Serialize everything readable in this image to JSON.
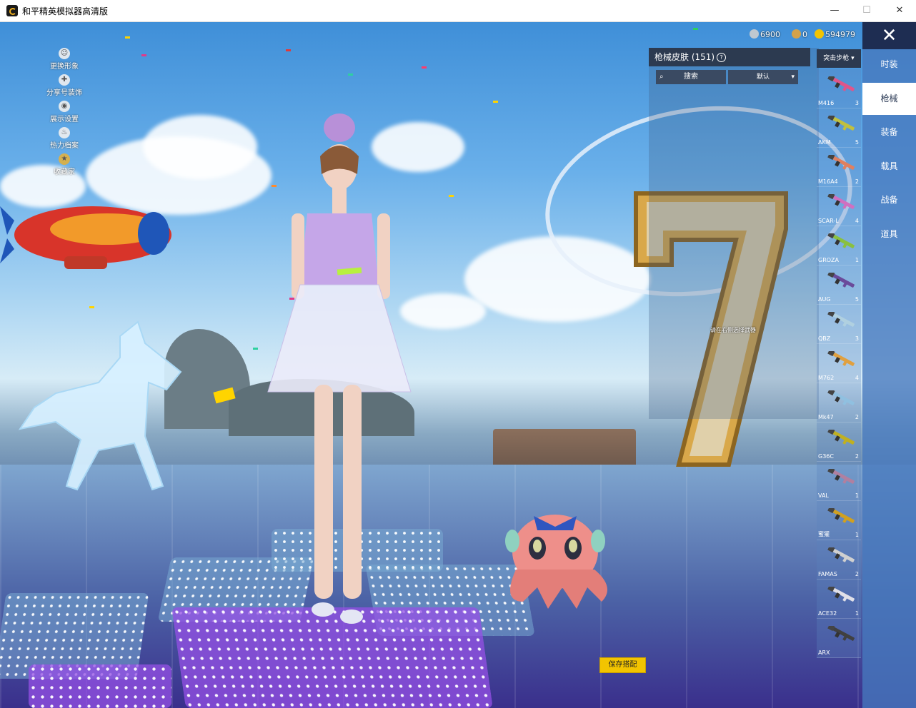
{
  "window": {
    "title": "和平精英模拟器高清版",
    "minimize": "—",
    "maximize": "☐",
    "close": "✕"
  },
  "left_menu": [
    {
      "icon": "avatar-icon",
      "label": "更换形象"
    },
    {
      "icon": "share-icon",
      "label": "分享号装饰"
    },
    {
      "icon": "eye-icon",
      "label": "展示设置"
    },
    {
      "icon": "flame-icon",
      "label": "热力档案"
    },
    {
      "icon": "badge-icon",
      "label": "收藏家"
    }
  ],
  "currency": [
    {
      "icon": "coin-silver-icon",
      "value": "6900",
      "color": "#c0c8d0"
    },
    {
      "icon": "coin-bronze-icon",
      "value": "0",
      "color": "#d4a24a"
    },
    {
      "icon": "coin-gold-icon",
      "value": "594979",
      "color": "#f2c400"
    }
  ],
  "right_tabs": [
    {
      "label": "时装",
      "active": false
    },
    {
      "label": "枪械",
      "active": true
    },
    {
      "label": "装备",
      "active": false
    },
    {
      "label": "载具",
      "active": false
    },
    {
      "label": "战备",
      "active": false
    },
    {
      "label": "道具",
      "active": false
    }
  ],
  "close_label": "✕",
  "panel": {
    "title": "枪械皮肤 (151)",
    "search_label": "搜索",
    "sort_label": "默认",
    "hint": "请在右侧选择武器"
  },
  "category_dropdown": "突击步枪",
  "guns": [
    {
      "name": "M416",
      "count": "3",
      "color": "#e0558a"
    },
    {
      "name": "AKM",
      "count": "5",
      "color": "#c0c040"
    },
    {
      "name": "M16A4",
      "count": "2",
      "color": "#e08060"
    },
    {
      "name": "SCAR-L",
      "count": "4",
      "color": "#d070c0"
    },
    {
      "name": "GROZA",
      "count": "1",
      "color": "#8ac040"
    },
    {
      "name": "AUG",
      "count": "5",
      "color": "#6a4a9a"
    },
    {
      "name": "QBZ",
      "count": "3",
      "color": "#b0d0e0"
    },
    {
      "name": "M762",
      "count": "4",
      "color": "#e0a040"
    },
    {
      "name": "Mk47",
      "count": "2",
      "color": "#90c0e0"
    },
    {
      "name": "G36C",
      "count": "2",
      "color": "#c0b020"
    },
    {
      "name": "VAL",
      "count": "1",
      "color": "#b080a0"
    },
    {
      "name": "蜜獾",
      "count": "1",
      "color": "#d0a020"
    },
    {
      "name": "FAMAS",
      "count": "2",
      "color": "#d0d0d0"
    },
    {
      "name": "ACE32",
      "count": "1",
      "color": "#e0e0e8"
    },
    {
      "name": "ARX",
      "count": "",
      "color": "#404040"
    }
  ],
  "save_button": "保存搭配"
}
